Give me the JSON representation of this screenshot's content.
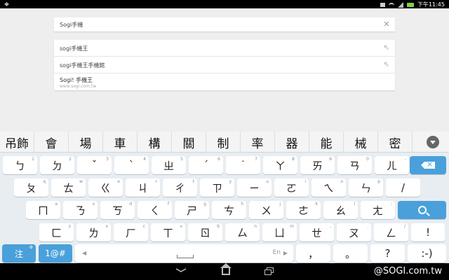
{
  "status": {
    "time": "下午11:45"
  },
  "search": {
    "value": "Sogi手機"
  },
  "suggestions": [
    {
      "text": "sogi手機王"
    },
    {
      "text": "sogi手機王手機館"
    }
  ],
  "site_suggestion": {
    "title": "Sogi! 手機王",
    "url": "www.sogi.com.tw"
  },
  "candidates": [
    "吊飾",
    "會",
    "場",
    "車",
    "構",
    "關",
    "制",
    "率",
    "器",
    "能",
    "械",
    "密"
  ],
  "keyboard": {
    "row1": [
      {
        "main": "ㄅ",
        "hint": "1"
      },
      {
        "main": "ㄉ",
        "hint": "2"
      },
      {
        "main": "ˇ",
        "hint": "3"
      },
      {
        "main": "ˋ",
        "hint": "4"
      },
      {
        "main": "ㄓ",
        "hint": "5"
      },
      {
        "main": "ˊ",
        "hint": "6"
      },
      {
        "main": "˙",
        "hint": "7"
      },
      {
        "main": "ㄚ",
        "hint": "8"
      },
      {
        "main": "ㄞ",
        "hint": "9"
      },
      {
        "main": "ㄢ",
        "hint": "0"
      },
      {
        "main": "ㄦ",
        "hint": "-"
      }
    ],
    "row2": [
      {
        "main": "ㄆ",
        "hint": "q"
      },
      {
        "main": "ㄊ",
        "hint": "w"
      },
      {
        "main": "ㄍ",
        "hint": "e"
      },
      {
        "main": "ㄐ",
        "hint": "r"
      },
      {
        "main": "ㄔ",
        "hint": "t"
      },
      {
        "main": "ㄗ",
        "hint": "y"
      },
      {
        "main": "ㄧ",
        "hint": "u"
      },
      {
        "main": "ㄛ",
        "hint": "i"
      },
      {
        "main": "ㄟ",
        "hint": "o"
      },
      {
        "main": "ㄣ",
        "hint": "p"
      },
      {
        "main": "/",
        "hint": ""
      }
    ],
    "row3": [
      {
        "main": "ㄇ",
        "hint": "a"
      },
      {
        "main": "ㄋ",
        "hint": "s"
      },
      {
        "main": "ㄎ",
        "hint": "d"
      },
      {
        "main": "ㄑ",
        "hint": "f"
      },
      {
        "main": "ㄕ",
        "hint": "g"
      },
      {
        "main": "ㄘ",
        "hint": "h"
      },
      {
        "main": "ㄨ",
        "hint": "j"
      },
      {
        "main": "ㄜ",
        "hint": "k"
      },
      {
        "main": "ㄠ",
        "hint": "l"
      },
      {
        "main": "ㄤ",
        "hint": ";"
      }
    ],
    "row4": [
      {
        "main": "ㄈ",
        "hint": "z"
      },
      {
        "main": "ㄌ",
        "hint": "x"
      },
      {
        "main": "ㄏ",
        "hint": "c"
      },
      {
        "main": "ㄒ",
        "hint": "v"
      },
      {
        "main": "ㄖ",
        "hint": "b"
      },
      {
        "main": "ㄙ",
        "hint": "n"
      },
      {
        "main": "ㄩ",
        "hint": "m"
      },
      {
        "main": "ㄝ",
        "hint": ","
      },
      {
        "main": "ㄡ",
        "hint": "."
      },
      {
        "main": "ㄥ",
        "hint": "/"
      },
      {
        "main": "!",
        "hint": ""
      }
    ],
    "row5": {
      "mode": "注",
      "numsym": "1@#",
      "space_lang": "En",
      "punct": [
        {
          "main": "，"
        },
        {
          "main": "。"
        },
        {
          "main": "?"
        },
        {
          "main": ":-)"
        }
      ]
    }
  },
  "watermark": "@SOGI.com.tw"
}
